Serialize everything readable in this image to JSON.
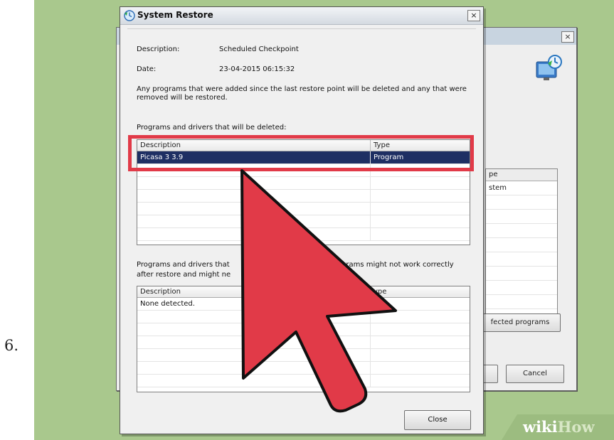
{
  "step": {
    "number": "6."
  },
  "watermark": {
    "part1": "wiki",
    "part2": "How"
  },
  "background_window": {
    "close_glyph": "×",
    "icon": "system-restore-monitor-icon",
    "list": {
      "header": "pe",
      "rows": [
        "stem"
      ]
    },
    "buttons": {
      "affected": "fected programs",
      "cancel": "Cancel"
    }
  },
  "dialog": {
    "title": "System Restore",
    "title_icon": "system-restore-icon",
    "close_glyph": "×",
    "description_label": "Description:",
    "description_value": "Scheduled Checkpoint",
    "date_label": "Date:",
    "date_value": "23-04-2015 06:15:32",
    "info_text": "Any programs that were added since the last restore point will be deleted and any that were removed will be restored.",
    "deleted_heading": "Programs and drivers that will be deleted:",
    "deleted_table": {
      "columns": [
        "Description",
        "Type"
      ],
      "rows": [
        {
          "description": "Picasa 3 3.9",
          "type": "Program",
          "selected": true
        }
      ]
    },
    "restored_heading_left": "Programs and drivers that",
    "restored_heading_right": "grams might not work correctly",
    "restored_heading_line2": "after restore and might ne",
    "restored_table": {
      "columns": [
        "Description",
        "ype"
      ],
      "rows": [
        {
          "description": "None detected.",
          "type": ""
        }
      ]
    },
    "close_button": "Close"
  },
  "annotation": {
    "arrow_color": "#e13a48",
    "highlight_color": "#e13a48"
  },
  "colors": {
    "background_green": "#a9c88d",
    "selection": "#1e2f63"
  }
}
